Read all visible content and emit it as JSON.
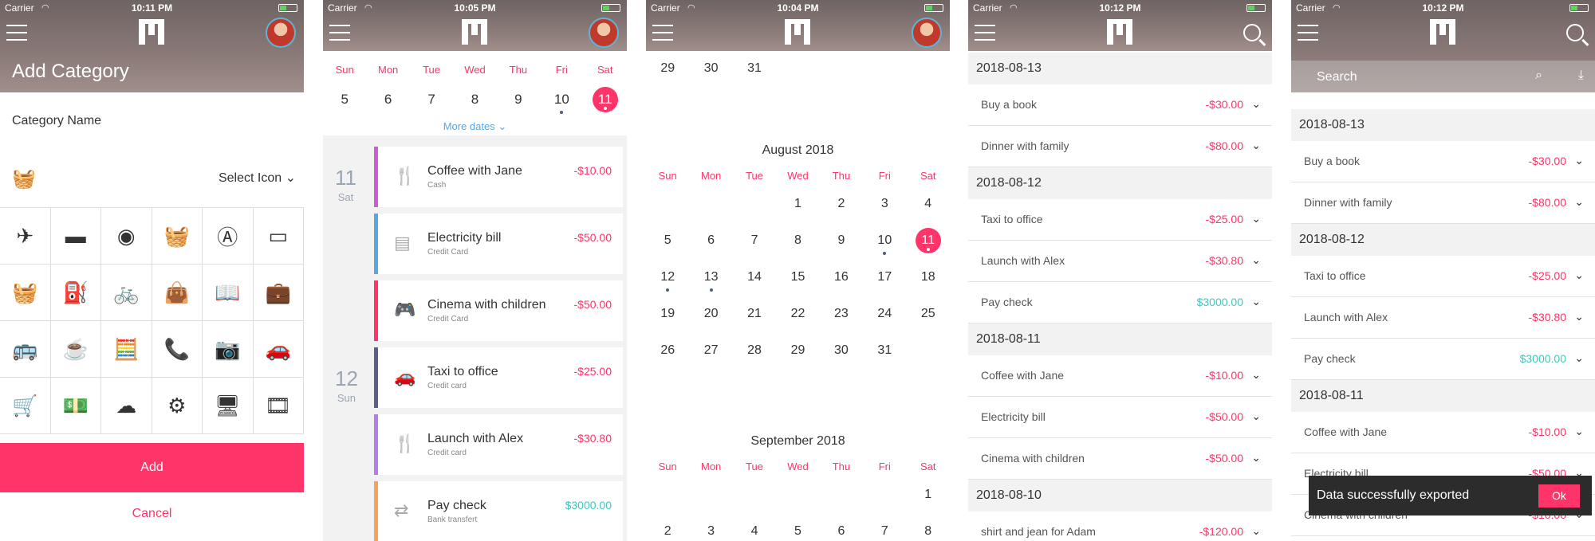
{
  "status": {
    "carrier": "Carrier",
    "wifi": "wifi-icon"
  },
  "screen1": {
    "time": "10:11 PM",
    "title": "Add Category",
    "category_name_label": "Category Name",
    "select_icon_label": "Select Icon",
    "icons": [
      "✈",
      "▬",
      "◉",
      "🧺",
      "Ⓐ",
      "▭",
      "🧺",
      "⛽",
      "🚲",
      "👜",
      "📖",
      "💼",
      "🚌",
      "☕",
      "🧮",
      "📞",
      "📷",
      "🚗",
      "🛒",
      "💵",
      "☁",
      "⚙",
      "🖥",
      "🎞"
    ],
    "add_label": "Add",
    "cancel_label": "Cancel"
  },
  "screen2": {
    "time": "10:05 PM",
    "week_days": [
      "Sun",
      "Mon",
      "Tue",
      "Wed",
      "Thu",
      "Fri",
      "Sat"
    ],
    "week_dates": [
      "5",
      "6",
      "7",
      "8",
      "9",
      "10",
      "11"
    ],
    "more_dates": "More dates",
    "day11": {
      "num": "11",
      "dow": "Sat"
    },
    "day12": {
      "num": "12",
      "dow": "Sun"
    },
    "transactions": [
      {
        "name": "Coffee with Jane",
        "method": "Cash",
        "amount": "-$10.00",
        "color": "#c95fd1"
      },
      {
        "name": "Electricity bill",
        "method": "Credit Card",
        "amount": "-$50.00",
        "color": "#5aa7e0"
      },
      {
        "name": "Cinema with children",
        "method": "Credit Card",
        "amount": "-$50.00",
        "color": "#ff3468"
      },
      {
        "name": "Taxi to office",
        "method": "Credit card",
        "amount": "-$25.00",
        "color": "#5d5d8a"
      },
      {
        "name": "Launch with Alex",
        "method": "Credit card",
        "amount": "-$30.80",
        "color": "#b57de6"
      },
      {
        "name": "Pay check",
        "method": "Bank transfert",
        "amount": "$3000.00",
        "color": "#f5a55a"
      }
    ]
  },
  "screen3": {
    "time": "10:04 PM",
    "prev_row": [
      "29",
      "30",
      "31"
    ],
    "august": {
      "title": "August 2018",
      "rows": [
        [
          "",
          "",
          "",
          "1",
          "2",
          "3",
          "4"
        ],
        [
          "5",
          "6",
          "7",
          "8",
          "9",
          "10",
          "11"
        ],
        [
          "12",
          "13",
          "14",
          "15",
          "16",
          "17",
          "18"
        ],
        [
          "19",
          "20",
          "21",
          "22",
          "23",
          "24",
          "25"
        ],
        [
          "26",
          "27",
          "28",
          "29",
          "30",
          "31",
          ""
        ]
      ]
    },
    "september": {
      "title": "September 2018",
      "rows": [
        [
          "",
          "",
          "",
          "",
          "",
          "",
          "1"
        ],
        [
          "2",
          "3",
          "4",
          "5",
          "6",
          "7",
          "8"
        ]
      ]
    }
  },
  "screen4": {
    "time": "10:12 PM",
    "groups": [
      {
        "date": "2018-08-13",
        "items": [
          {
            "name": "Buy a book",
            "amount": "-$30.00"
          },
          {
            "name": "Dinner with family",
            "amount": "-$80.00"
          }
        ]
      },
      {
        "date": "2018-08-12",
        "items": [
          {
            "name": "Taxi to office",
            "amount": "-$25.00"
          },
          {
            "name": "Launch with Alex",
            "amount": "-$30.80"
          },
          {
            "name": "Pay check",
            "amount": "$3000.00"
          }
        ]
      },
      {
        "date": "2018-08-11",
        "items": [
          {
            "name": "Coffee with Jane",
            "amount": "-$10.00"
          },
          {
            "name": "Electricity bill",
            "amount": "-$50.00"
          },
          {
            "name": "Cinema with children",
            "amount": "-$50.00"
          }
        ]
      },
      {
        "date": "2018-08-10",
        "items": [
          {
            "name": "shirt and jean for Adam",
            "amount": "-$120.00"
          }
        ]
      }
    ]
  },
  "screen5": {
    "time": "10:12 PM",
    "search_placeholder": "Search",
    "toast_text": "Data successfully exported",
    "toast_ok": "Ok",
    "groups": [
      {
        "date": "2018-08-13",
        "items": [
          {
            "name": "Buy a book",
            "amount": "-$30.00"
          },
          {
            "name": "Dinner with family",
            "amount": "-$80.00"
          }
        ]
      },
      {
        "date": "2018-08-12",
        "items": [
          {
            "name": "Taxi to office",
            "amount": "-$25.00"
          },
          {
            "name": "Launch with Alex",
            "amount": "-$30.80"
          },
          {
            "name": "Pay check",
            "amount": "$3000.00"
          }
        ]
      },
      {
        "date": "2018-08-11",
        "items": [
          {
            "name": "Coffee with Jane",
            "amount": "-$10.00"
          },
          {
            "name": "Electricity bill",
            "amount": "-$50.00"
          },
          {
            "name": "Cinema with children",
            "amount": "-$10.00"
          }
        ]
      }
    ]
  },
  "colors": {
    "accent": "#ff3468",
    "positive": "#3fc7c0",
    "link": "#5aa7e0"
  }
}
